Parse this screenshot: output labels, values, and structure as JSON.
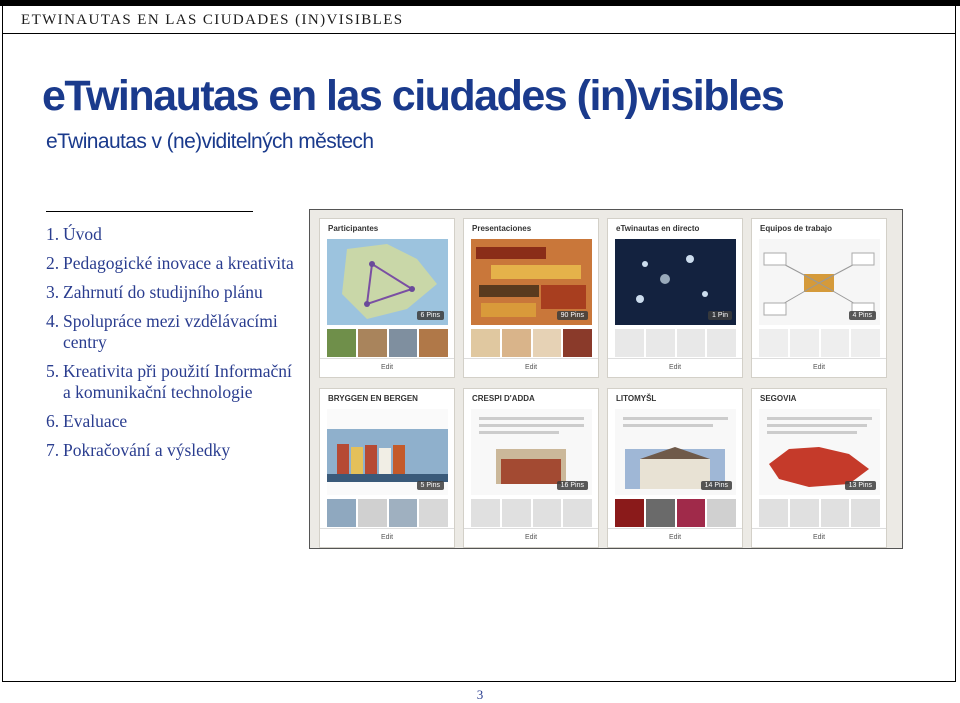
{
  "header": {
    "running_title": "ETWINAUTAS EN LAS CIUDADES (IN)VISIBLES"
  },
  "slide": {
    "title": "eTwinautas en las ciudades (in)visibles",
    "subtitle": "eTwinautas v (ne)viditelných městech"
  },
  "toc": [
    {
      "num": "1.",
      "text": "Úvod"
    },
    {
      "num": "2.",
      "text": "Pedagogické inovace a kreativita"
    },
    {
      "num": "3.",
      "text": "Zahrnutí do studijního plánu"
    },
    {
      "num": "4.",
      "text": "Spolupráce mezi vzdělávacími centry"
    },
    {
      "num": "5.",
      "text": "Kreativita při použití Informační a komunikační technologie"
    },
    {
      "num": "6.",
      "text": "Evaluace"
    },
    {
      "num": "7.",
      "text": "Pokračování a výsledky"
    }
  ],
  "boards": [
    {
      "title": "Participantes",
      "pins": "6 Pins",
      "edit": "Edit",
      "cover_color": "#7aa6c9"
    },
    {
      "title": "Presentaciones",
      "pins": "90 Pins",
      "edit": "Edit",
      "cover_color": "#c9773a"
    },
    {
      "title": "eTwinautas en directo",
      "pins": "1 Pin",
      "edit": "Edit",
      "cover_color": "#13223f"
    },
    {
      "title": "Equipos de trabajo",
      "pins": "4 Pins",
      "edit": "Edit",
      "cover_color": "#f3f3f3"
    },
    {
      "title": "BRYGGEN EN BERGEN",
      "pins": "5 Pins",
      "edit": "Edit",
      "cover_color": "#b64a34"
    },
    {
      "title": "CRESPI D'ADDA",
      "pins": "16 Pins",
      "edit": "Edit",
      "cover_color": "#d8c9a8"
    },
    {
      "title": "LITOMYŠL",
      "pins": "14 Pins",
      "edit": "Edit",
      "cover_color": "#8f9aa3"
    },
    {
      "title": "SEGOVIA",
      "pins": "13 Pins",
      "edit": "Edit",
      "cover_color": "#c53a2a"
    }
  ],
  "page_number": "3"
}
